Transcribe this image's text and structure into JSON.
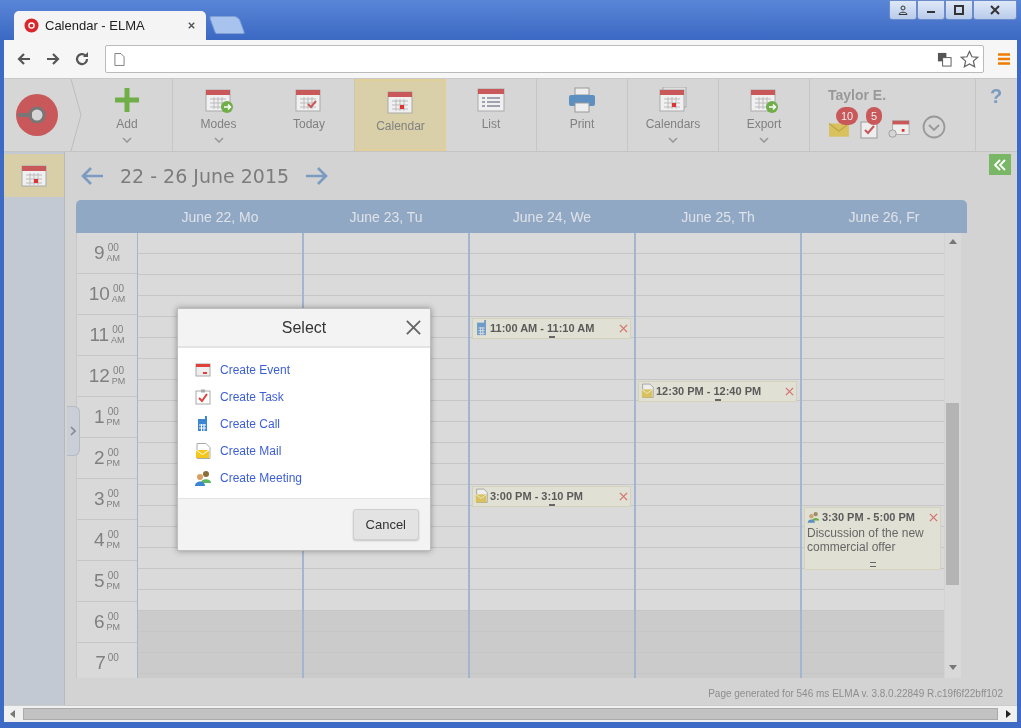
{
  "browser": {
    "tab_title": "Calendar - ELMA"
  },
  "toolbar": {
    "items": [
      {
        "kind": "add",
        "label": "Add",
        "menu": true,
        "selected": false
      },
      {
        "kind": "modes",
        "label": "Modes",
        "menu": true,
        "selected": false
      },
      {
        "kind": "today",
        "label": "Today",
        "menu": false,
        "selected": false
      },
      {
        "kind": "calendar",
        "label": "Calendar",
        "menu": false,
        "selected": true
      },
      {
        "kind": "list",
        "label": "List",
        "menu": false,
        "selected": false
      },
      {
        "kind": "print",
        "label": "Print",
        "menu": false,
        "selected": false
      },
      {
        "kind": "calendars",
        "label": "Calendars",
        "menu": true,
        "selected": false
      },
      {
        "kind": "export",
        "label": "Export",
        "menu": true,
        "selected": false
      }
    ]
  },
  "user": {
    "name": "Taylor E.",
    "badges": [
      {
        "kind": "mail",
        "count": "10"
      },
      {
        "kind": "task",
        "count": "5"
      },
      {
        "kind": "calendar"
      }
    ]
  },
  "help": "?",
  "sidebar": {
    "items": [
      {
        "kind": "calendar",
        "selected": true
      }
    ]
  },
  "date_range": "22 - 26 June 2015",
  "days": [
    {
      "label": "June 22, Mo"
    },
    {
      "label": "June 23, Tu"
    },
    {
      "label": "June 24, We",
      "events": [
        {
          "kind": "call",
          "time": "11:00 AM - 11:10 AM"
        },
        {
          "kind": "mail",
          "time": "3:00 PM - 3:10 PM"
        }
      ]
    },
    {
      "label": "June 25, Th",
      "events": [
        {
          "kind": "mail",
          "time": "12:30 PM - 12:40 PM"
        }
      ]
    },
    {
      "label": "June 26, Fr",
      "events": [
        {
          "kind": "meeting",
          "time": "3:30 PM - 5:00 PM",
          "title": "Discussion of the new commercial offer"
        }
      ]
    }
  ],
  "time_rows": [
    {
      "hour": "9",
      "minutes": "00",
      "period": "AM",
      "off_hours": false
    },
    {
      "hour": "10",
      "minutes": "00",
      "period": "AM",
      "off_hours": false
    },
    {
      "hour": "11",
      "minutes": "00",
      "period": "AM",
      "off_hours": false
    },
    {
      "hour": "12",
      "minutes": "00",
      "period": "PM",
      "off_hours": false
    },
    {
      "hour": "1",
      "minutes": "00",
      "period": "PM",
      "off_hours": false
    },
    {
      "hour": "2",
      "minutes": "00",
      "period": "PM",
      "off_hours": false
    },
    {
      "hour": "3",
      "minutes": "00",
      "period": "PM",
      "off_hours": false
    },
    {
      "hour": "4",
      "minutes": "00",
      "period": "PM",
      "off_hours": false
    },
    {
      "hour": "5",
      "minutes": "00",
      "period": "PM",
      "off_hours": false
    },
    {
      "hour": "6",
      "minutes": "00",
      "period": "PM",
      "off_hours": true
    },
    {
      "hour": "7",
      "minutes": "00",
      "off_hours": true
    }
  ],
  "dialog": {
    "title": "Select",
    "options": [
      {
        "kind": "event",
        "label": "Create Event"
      },
      {
        "kind": "task",
        "label": "Create Task"
      },
      {
        "kind": "call",
        "label": "Create Call"
      },
      {
        "kind": "mail",
        "label": "Create Mail"
      },
      {
        "kind": "meeting",
        "label": "Create Meeting"
      }
    ],
    "cancel": "Cancel"
  },
  "footer": "Page generated for 546 ms ELMA v. 3.8.0.22849 R.c19f6f22bff102"
}
